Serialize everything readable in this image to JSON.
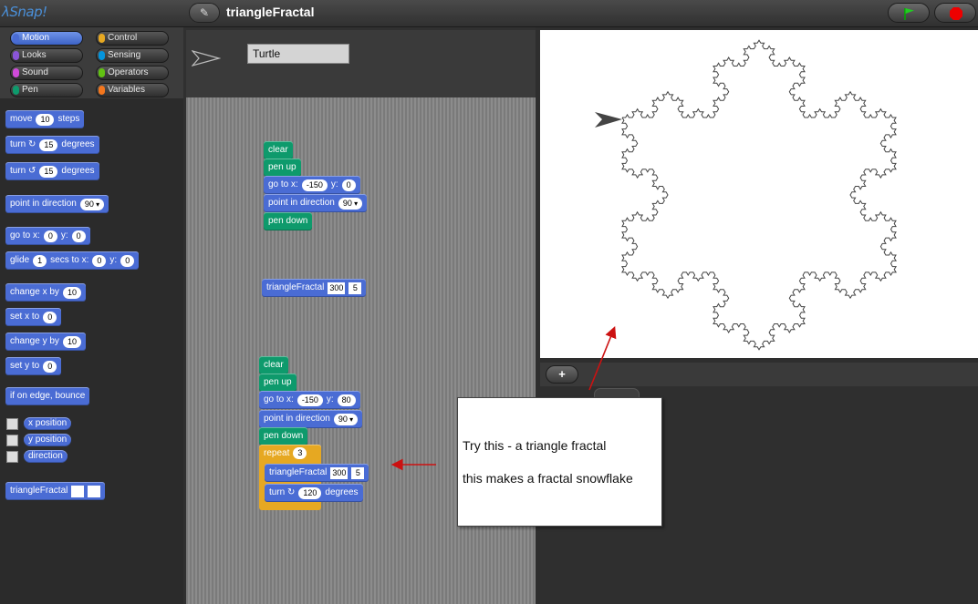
{
  "app": {
    "logo": "λSnap!",
    "project_title": "triangleFractal",
    "edit_icon": "pencil-icon"
  },
  "categories": [
    {
      "label": "Motion",
      "color": "#4a6cd4"
    },
    {
      "label": "Control",
      "color": "#e6a822"
    },
    {
      "label": "Looks",
      "color": "#8a55d7"
    },
    {
      "label": "Sensing",
      "color": "#0494dc"
    },
    {
      "label": "Sound",
      "color": "#cf4ad9"
    },
    {
      "label": "Operators",
      "color": "#62c213"
    },
    {
      "label": "Pen",
      "color": "#0e9a6c"
    },
    {
      "label": "Variables",
      "color": "#f3761d"
    }
  ],
  "palette": {
    "move": [
      "move",
      "10",
      "steps"
    ],
    "turn_cw": [
      "turn ↻",
      "15",
      "degrees"
    ],
    "turn_ccw": [
      "turn ↺",
      "15",
      "degrees"
    ],
    "point_dir": [
      "point in direction",
      "90"
    ],
    "goto": [
      "go to x:",
      "0",
      "y:",
      "0"
    ],
    "glide": [
      "glide",
      "1",
      "secs to x:",
      "0",
      "y:",
      "0"
    ],
    "change_x": [
      "change x by",
      "10"
    ],
    "set_x": [
      "set x to",
      "0"
    ],
    "change_y": [
      "change y by",
      "10"
    ],
    "set_y": [
      "set y to",
      "0"
    ],
    "bounce": "if on edge, bounce",
    "x_position": "x position",
    "y_position": "y position",
    "direction": "direction",
    "triangle_fractal": "triangleFractal"
  },
  "sprite": {
    "name": "Turtle"
  },
  "script1": {
    "clear": "clear",
    "pen_up": "pen up",
    "goto": [
      "go to x:",
      "-150",
      "y:",
      "0"
    ],
    "point_dir": [
      "point in direction",
      "90"
    ],
    "pen_down": "pen down"
  },
  "script2": {
    "label": "triangleFractal",
    "arg1": "300",
    "arg2": "5"
  },
  "script3": {
    "clear": "clear",
    "pen_up": "pen up",
    "goto": [
      "go to x:",
      "-150",
      "y:",
      "80"
    ],
    "point_dir": [
      "point in direction",
      "90"
    ],
    "pen_down": "pen down",
    "repeat": [
      "repeat",
      "3"
    ],
    "fractal": [
      "triangleFractal",
      "300",
      "5"
    ],
    "turn": [
      "turn ↻",
      "120",
      "degrees"
    ]
  },
  "stage_controls": {
    "add_sprite": "+"
  },
  "callout": {
    "line1": "Try this - a triangle fractal",
    "line2": "this makes a fractal snowflake"
  }
}
